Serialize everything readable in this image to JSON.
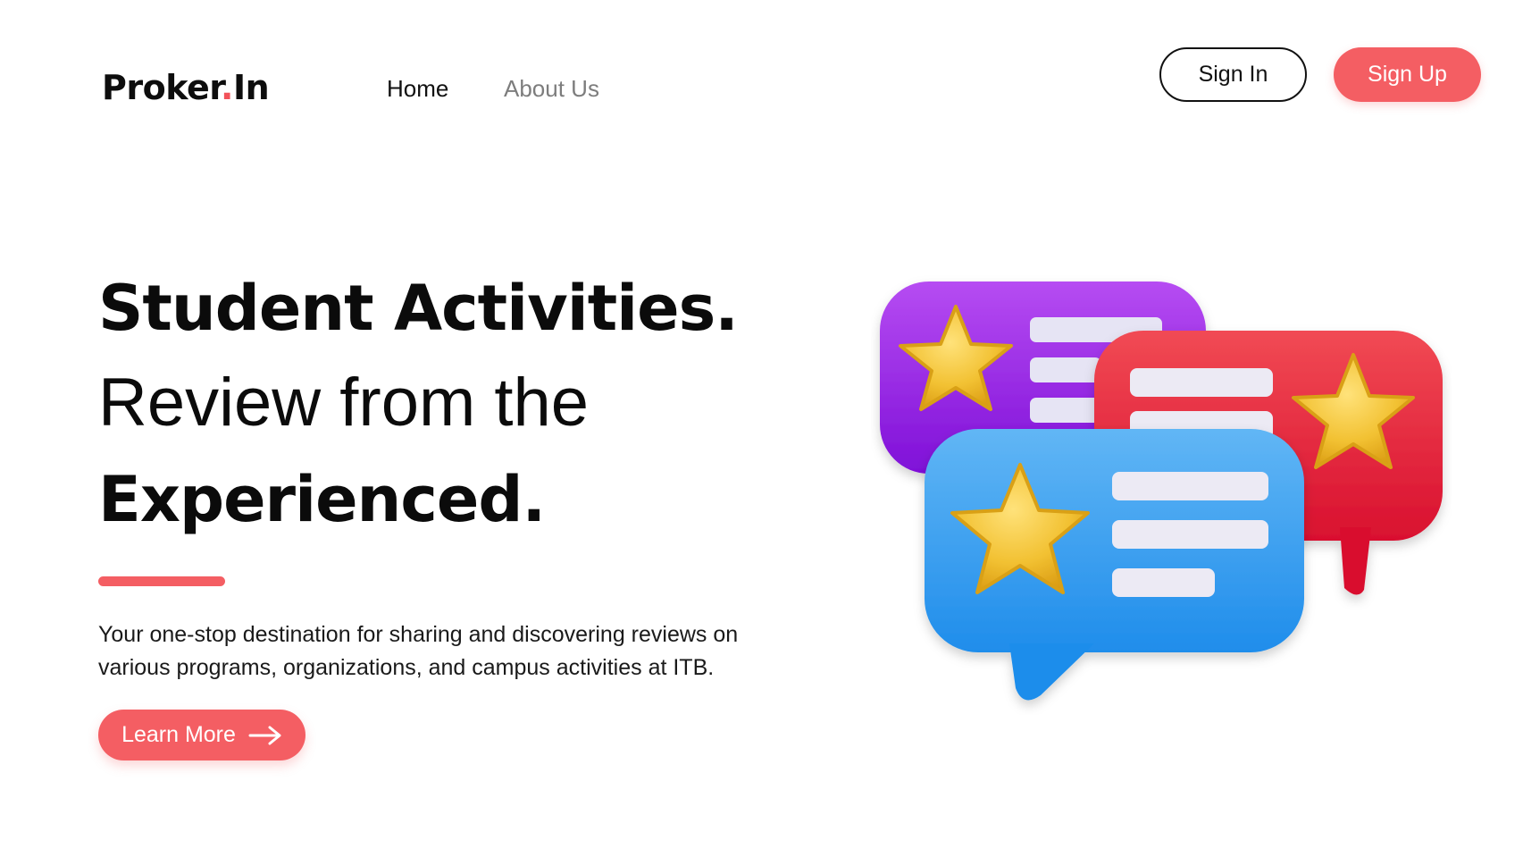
{
  "header": {
    "logo_main": "Proker",
    "logo_dot": ".",
    "logo_suffix": "In",
    "nav": [
      {
        "label": "Home",
        "active": true
      },
      {
        "label": "About Us",
        "active": false
      }
    ],
    "sign_in_label": "Sign In",
    "sign_up_label": "Sign Up"
  },
  "hero": {
    "line1": "Student Activities.",
    "line2": "Review from the",
    "line3": "Experienced.",
    "description_line1": "Your one-stop destination for sharing and discovering reviews on",
    "description_line2": "various programs, organizations, and campus activities at ITB.",
    "cta_label": "Learn More",
    "cta_icon": "arrow-right-icon"
  },
  "illustration": {
    "name": "review-chat-bubbles",
    "icons": [
      "star-icon",
      "star-icon",
      "star-icon"
    ]
  },
  "colors": {
    "accent": "#f45e63",
    "text": "#0f0f0f",
    "muted_nav": "#7d7d7d",
    "bubble_purple": "#9b1ee0",
    "bubble_red": "#e8213a",
    "bubble_blue": "#2e9bef",
    "star": "#f1c232"
  }
}
